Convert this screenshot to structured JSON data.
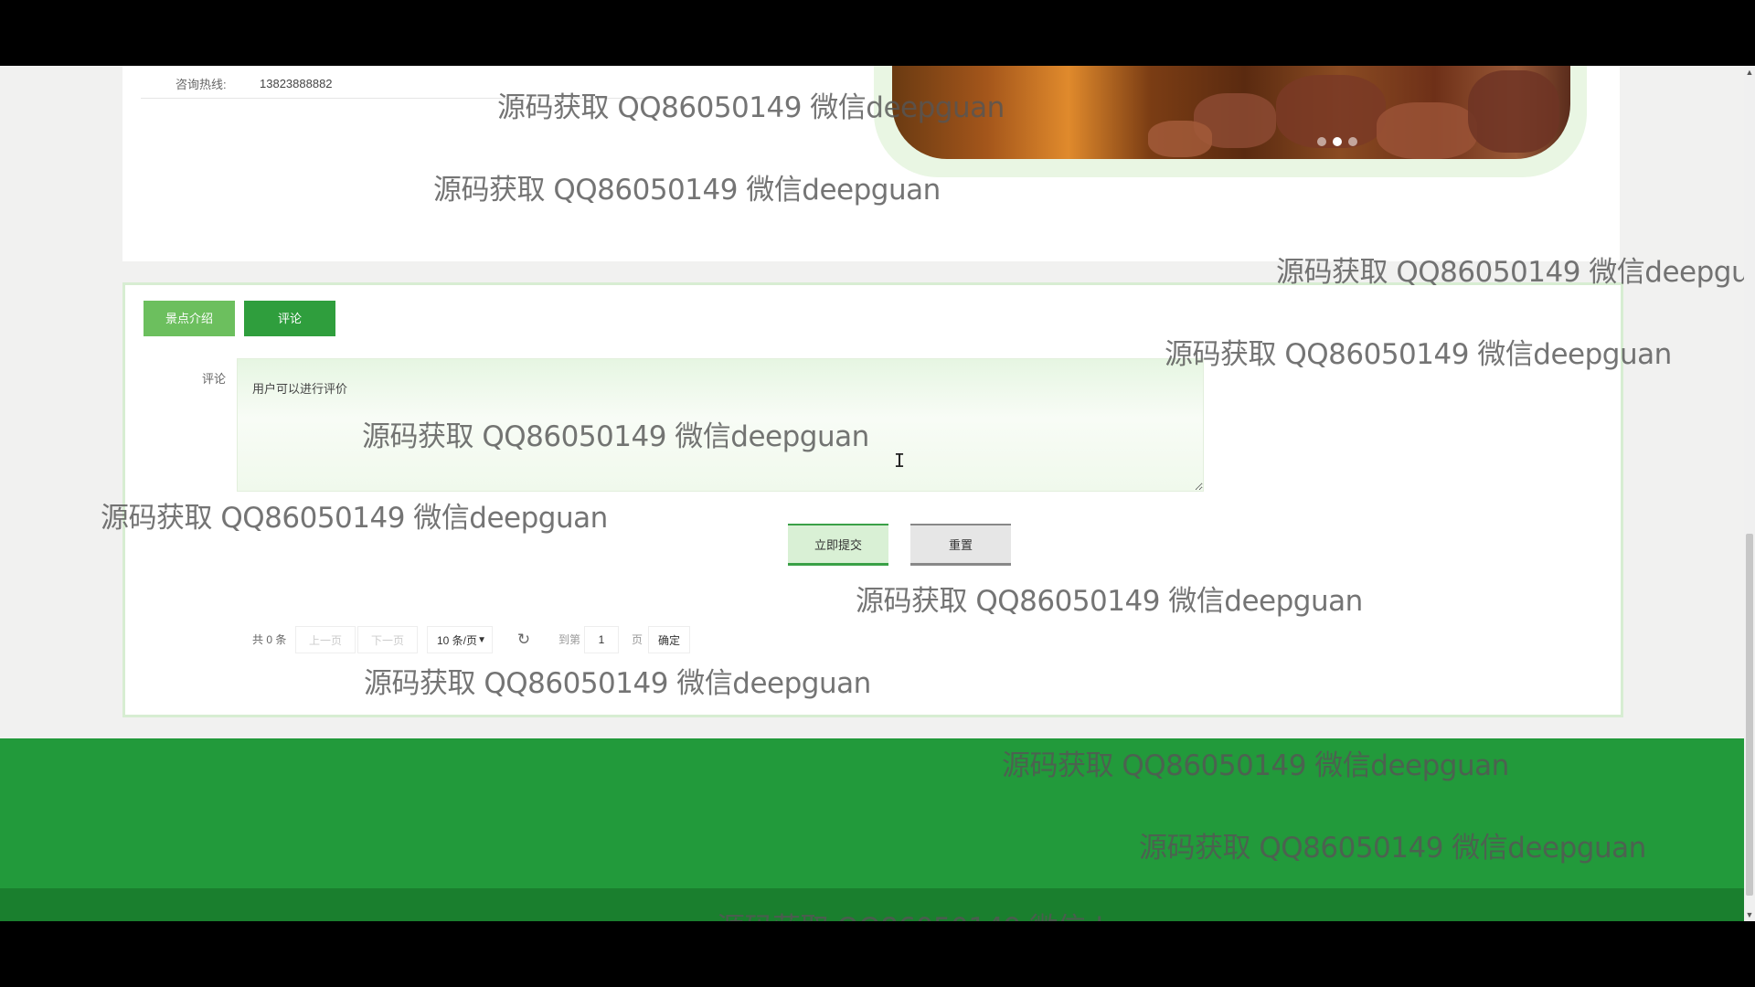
{
  "spot_info": {
    "hotline_label": "咨询热线:",
    "hotline_value": "13823888882"
  },
  "carousel": {
    "dots": [
      {
        "active": false
      },
      {
        "active": true
      },
      {
        "active": false
      }
    ]
  },
  "tabs": [
    {
      "label": "景点介绍"
    },
    {
      "label": "评论"
    }
  ],
  "comment_form": {
    "label": "评论",
    "placeholder": "用户可以进行评价",
    "submit_label": "立即提交",
    "reset_label": "重置"
  },
  "pagination": {
    "total": "共 0 条",
    "prev_label": "上一页",
    "next_label": "下一页",
    "page_size": "10 条/页",
    "goto_label": "到第",
    "page_value": "1",
    "page_unit": "页",
    "confirm_label": "确定"
  },
  "watermark": "源码获取 QQ86050149 微信deepguan",
  "colors": {
    "accent_green": "#229a3b",
    "tab_light": "#6cbf5e",
    "tab_active": "#2f9e3d"
  }
}
